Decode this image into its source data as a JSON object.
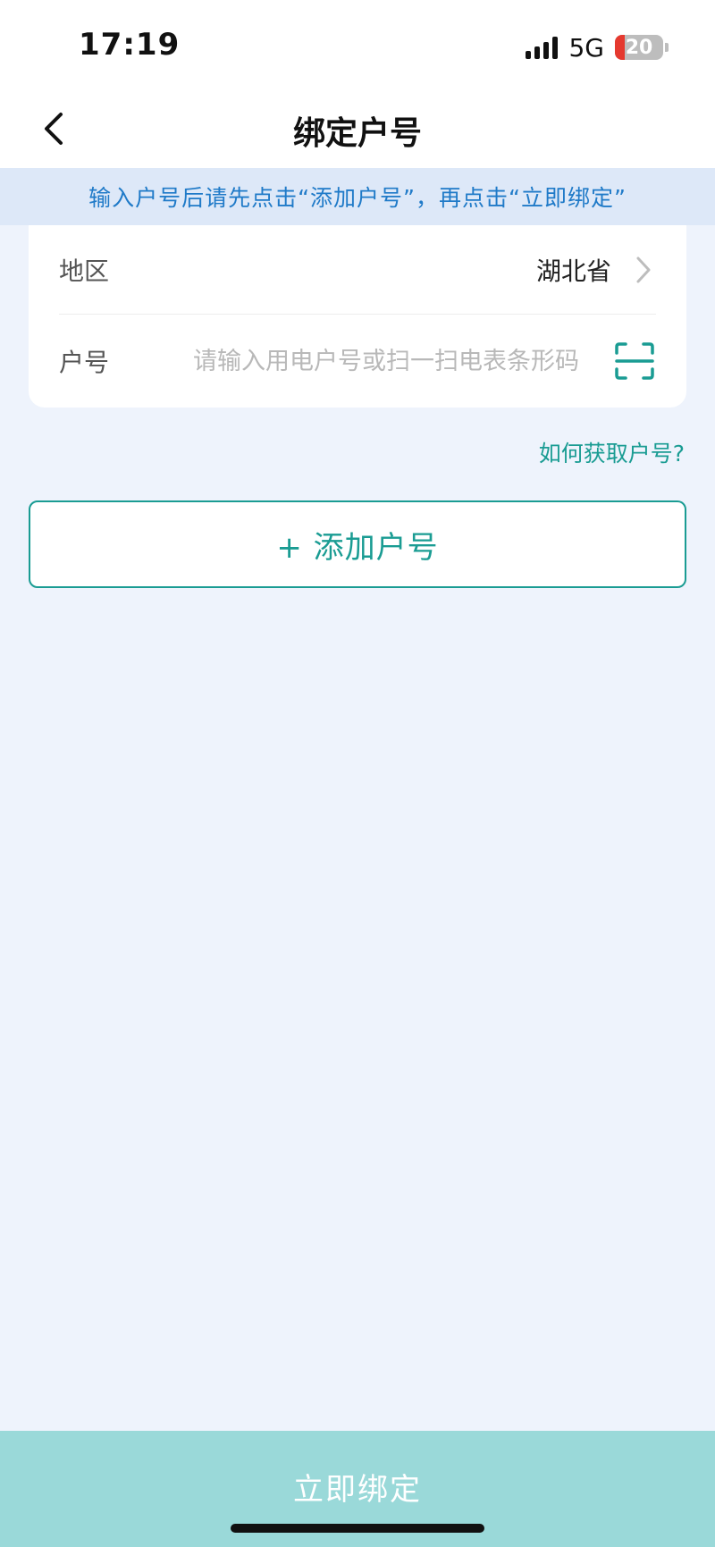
{
  "status_bar": {
    "time": "17:19",
    "network": "5G",
    "battery_level": "20",
    "battery_fraction": 0.2,
    "battery_low_color": "#E5392F"
  },
  "nav": {
    "title": "绑定户号",
    "back_icon": "chevron-left-icon"
  },
  "notice": {
    "text": "输入户号后请先点击“添加户号”，再点击“立即绑定”",
    "color": "#1F7AC8"
  },
  "form": {
    "region": {
      "label": "地区",
      "value": "湖北省",
      "icon": "chevron-right-icon"
    },
    "account": {
      "label": "户号",
      "value": "",
      "placeholder": "请输入用电户号或扫一扫电表条形码",
      "icon": "scan-icon"
    }
  },
  "help_link": "如何获取户号?",
  "add_button": {
    "label": "+ 添加户号"
  },
  "bind_button": {
    "label": "立即绑定"
  },
  "colors": {
    "accent": "#1A9C93",
    "page_background": "#EEF3FC",
    "bind_button_background": "#9AD9D9"
  }
}
